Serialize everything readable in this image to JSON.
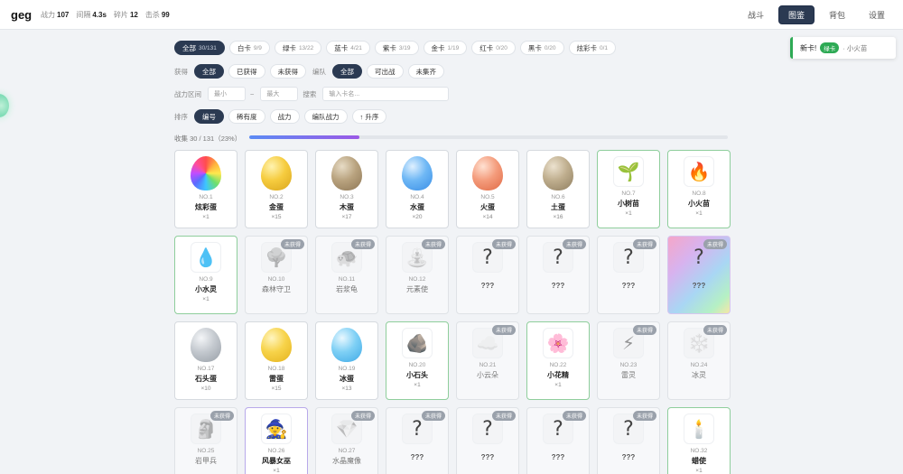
{
  "header": {
    "brand": "geg",
    "stats": [
      {
        "label": "战力",
        "value": "107"
      },
      {
        "label": "间隔",
        "value": "4.3s"
      },
      {
        "label": "碎片",
        "value": "12"
      },
      {
        "label": "击杀",
        "value": "99"
      }
    ],
    "nav": [
      {
        "label": "战斗",
        "active": false
      },
      {
        "label": "图鉴",
        "active": true
      },
      {
        "label": "背包",
        "active": false
      },
      {
        "label": "设置",
        "active": false
      }
    ]
  },
  "rarity_tabs": [
    {
      "label": "全部",
      "count": "30/131",
      "active": true
    },
    {
      "label": "白卡",
      "count": "9/9",
      "active": false
    },
    {
      "label": "绿卡",
      "count": "13/22",
      "active": false
    },
    {
      "label": "蓝卡",
      "count": "4/21",
      "active": false
    },
    {
      "label": "紫卡",
      "count": "3/19",
      "active": false
    },
    {
      "label": "金卡",
      "count": "1/19",
      "active": false
    },
    {
      "label": "红卡",
      "count": "0/20",
      "active": false
    },
    {
      "label": "黑卡",
      "count": "0/20",
      "active": false
    },
    {
      "label": "炫彩卡",
      "count": "0/1",
      "active": false
    }
  ],
  "filters": {
    "obtain_label": "获得",
    "obtain_options": [
      "全部",
      "已获得",
      "未获得"
    ],
    "team_label": "编队",
    "team_options": [
      "全部",
      "可出战",
      "未集齐"
    ],
    "power_label": "战力区间",
    "power_min_placeholder": "最小",
    "power_sep": "~",
    "power_max_placeholder": "最大",
    "search_label": "搜索",
    "search_placeholder": "输入卡名..."
  },
  "sort": {
    "label": "排序",
    "options": [
      "编号",
      "稀有度",
      "战力",
      "编队战力"
    ],
    "active": "编号",
    "order_button": "↑ 升序"
  },
  "progress": {
    "text": "收集 30 / 131（23%）",
    "fraction": 0.23
  },
  "toast": {
    "prefix": "新卡!",
    "tag": "绿卡",
    "text": "· 小火苗"
  },
  "cards": [
    {
      "no": "NO.1",
      "name": "炫彩蛋",
      "count": "×1",
      "art": "egg-rainbow",
      "state": "owned",
      "border": "plain"
    },
    {
      "no": "NO.2",
      "name": "金蛋",
      "count": "×15",
      "art": "egg-gold",
      "state": "owned",
      "border": "plain"
    },
    {
      "no": "NO.3",
      "name": "木蛋",
      "count": "×17",
      "art": "egg-wood",
      "state": "owned",
      "border": "plain"
    },
    {
      "no": "NO.4",
      "name": "水蛋",
      "count": "×20",
      "art": "egg-water",
      "state": "owned",
      "border": "plain"
    },
    {
      "no": "NO.5",
      "name": "火蛋",
      "count": "×14",
      "art": "egg-fire",
      "state": "owned",
      "border": "plain"
    },
    {
      "no": "NO.6",
      "name": "土蛋",
      "count": "×16",
      "art": "egg-earth",
      "state": "owned",
      "border": "plain"
    },
    {
      "no": "NO.7",
      "name": "小树苗",
      "count": "×1",
      "art": "🌱",
      "state": "owned",
      "border": "green"
    },
    {
      "no": "NO.8",
      "name": "小火苗",
      "count": "×1",
      "art": "🔥",
      "state": "owned",
      "border": "green"
    },
    {
      "no": "NO.9",
      "name": "小水灵",
      "count": "×1",
      "art": "💧",
      "state": "owned",
      "border": "green"
    },
    {
      "no": "NO.10",
      "name": "森林守卫",
      "count": "",
      "art": "🌳",
      "state": "locked",
      "border": "plain"
    },
    {
      "no": "NO.11",
      "name": "岩浆龟",
      "count": "",
      "art": "🐢",
      "state": "locked",
      "border": "plain"
    },
    {
      "no": "NO.12",
      "name": "元素使",
      "count": "",
      "art": "⛲",
      "state": "locked",
      "border": "plain"
    },
    {
      "no": "",
      "name": "???",
      "count": "",
      "art": "?",
      "state": "unknown",
      "border": "plain"
    },
    {
      "no": "",
      "name": "???",
      "count": "",
      "art": "?",
      "state": "unknown",
      "border": "plain"
    },
    {
      "no": "",
      "name": "???",
      "count": "",
      "art": "?",
      "state": "unknown",
      "border": "plain"
    },
    {
      "no": "",
      "name": "???",
      "count": "",
      "art": "?",
      "state": "rainbow",
      "border": "plain"
    },
    {
      "no": "NO.17",
      "name": "石头蛋",
      "count": "×10",
      "art": "egg-stone",
      "state": "owned",
      "border": "plain"
    },
    {
      "no": "NO.18",
      "name": "雷蛋",
      "count": "×15",
      "art": "egg-thunder",
      "state": "owned",
      "border": "plain"
    },
    {
      "no": "NO.19",
      "name": "冰蛋",
      "count": "×13",
      "art": "egg-ice",
      "state": "owned",
      "border": "plain"
    },
    {
      "no": "NO.20",
      "name": "小石头",
      "count": "×1",
      "art": "🪨",
      "state": "owned",
      "border": "green"
    },
    {
      "no": "NO.21",
      "name": "小云朵",
      "count": "",
      "art": "☁️",
      "state": "locked",
      "border": "plain"
    },
    {
      "no": "NO.22",
      "name": "小花精",
      "count": "×1",
      "art": "🌸",
      "state": "owned",
      "border": "green"
    },
    {
      "no": "NO.23",
      "name": "雷灵",
      "count": "",
      "art": "⚡",
      "state": "locked",
      "border": "plain"
    },
    {
      "no": "NO.24",
      "name": "冰灵",
      "count": "",
      "art": "❄️",
      "state": "locked",
      "border": "plain"
    },
    {
      "no": "NO.25",
      "name": "岩甲兵",
      "count": "",
      "art": "🗿",
      "state": "locked",
      "border": "plain"
    },
    {
      "no": "NO.26",
      "name": "风暴女巫",
      "count": "×1",
      "art": "🧙",
      "state": "owned",
      "border": "purple"
    },
    {
      "no": "NO.27",
      "name": "水晶魔像",
      "count": "",
      "art": "💎",
      "state": "locked",
      "border": "plain"
    },
    {
      "no": "",
      "name": "???",
      "count": "",
      "art": "?",
      "state": "unknown",
      "border": "plain"
    },
    {
      "no": "",
      "name": "???",
      "count": "",
      "art": "?",
      "state": "unknown",
      "border": "plain"
    },
    {
      "no": "",
      "name": "???",
      "count": "",
      "art": "?",
      "state": "unknown",
      "border": "plain"
    },
    {
      "no": "",
      "name": "???",
      "count": "",
      "art": "?",
      "state": "unknown",
      "border": "plain"
    },
    {
      "no": "NO.32",
      "name": "蜡使",
      "count": "×1",
      "art": "🕯️",
      "state": "owned",
      "border": "green"
    }
  ],
  "locked_badge": "未获得",
  "egg_colors": {
    "egg-rainbow": "conic-gradient(from 0deg, #ff4d4d, #ffb23d, #ffe84d, #6ddf6d, #3dc6ff, #5a6cff, #c04dff, #ff4d9a, #ff4d4d)",
    "egg-gold": "radial-gradient(circle at 35% 30%, #fff3b0, #f6cc3f 45%, #d9a51c)",
    "egg-wood": "radial-gradient(circle at 35% 30%, #e7dcc6, #b9a37f 45%, #8d7655)",
    "egg-water": "radial-gradient(circle at 35% 30%, #dff0ff, #6fb8f5 45%, #3a8ee6)",
    "egg-fire": "radial-gradient(circle at 35% 30%, #ffe1d2, #f49c7c 45%, #e06a45)",
    "egg-earth": "radial-gradient(circle at 35% 30%, #ece2cf, #bfae8e 45%, #8f7e60)",
    "egg-stone": "radial-gradient(circle at 35% 30%, #f4f6f8, #c4c9cf 45%, #979ea6)",
    "egg-thunder": "radial-gradient(circle at 35% 30%, #fff5c0, #f7d34a 45%, #e4b21d)",
    "egg-ice": "radial-gradient(circle at 35% 30%, #e9f8ff, #7fd0f5 45%, #3fa9e6)"
  }
}
